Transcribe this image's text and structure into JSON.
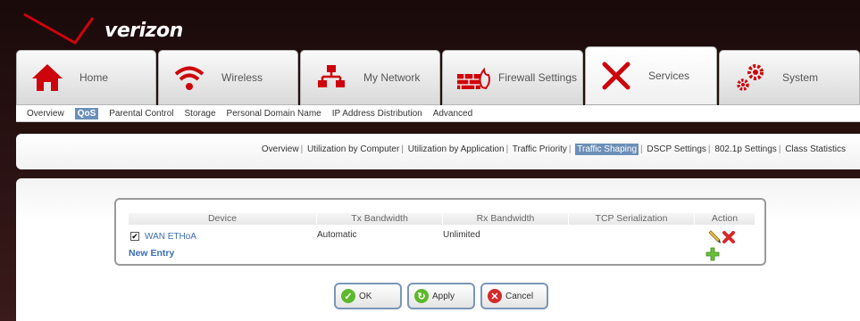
{
  "brand": {
    "logo_text": "verizon"
  },
  "tabs": [
    {
      "label": "Home",
      "icon": "home-icon"
    },
    {
      "label": "Wireless",
      "icon": "wireless-icon"
    },
    {
      "label": "My Network",
      "icon": "network-icon"
    },
    {
      "label": "Firewall Settings",
      "icon": "firewall-icon"
    },
    {
      "label": "Services",
      "icon": "tools-icon"
    },
    {
      "label": "System",
      "icon": "gears-icon"
    }
  ],
  "subnav": [
    "Overview",
    "QoS",
    "Parental Control",
    "Storage",
    "Personal Domain Name",
    "IP Address Distribution",
    "Advanced"
  ],
  "qos_links": [
    "Overview",
    "Utilization by Computer",
    "Utilization by Application",
    "Traffic Priority",
    "Traffic Shaping",
    "DSCP Settings",
    "802.1p Settings",
    "Class Statistics"
  ],
  "table": {
    "headers": [
      "Device",
      "Tx Bandwidth",
      "Rx Bandwidth",
      "TCP Serialization",
      "Action"
    ],
    "row": {
      "checked_mark": "✔",
      "device": "WAN ETHoA",
      "tx": "Automatic",
      "rx": "Unlimited"
    },
    "new_entry": "New Entry"
  },
  "buttons": {
    "ok": "OK",
    "apply": "Apply",
    "cancel": "Cancel"
  },
  "colors": {
    "accent": "#6b8fb8",
    "brand_red": "#cd040b",
    "link": "#3a6db5"
  }
}
